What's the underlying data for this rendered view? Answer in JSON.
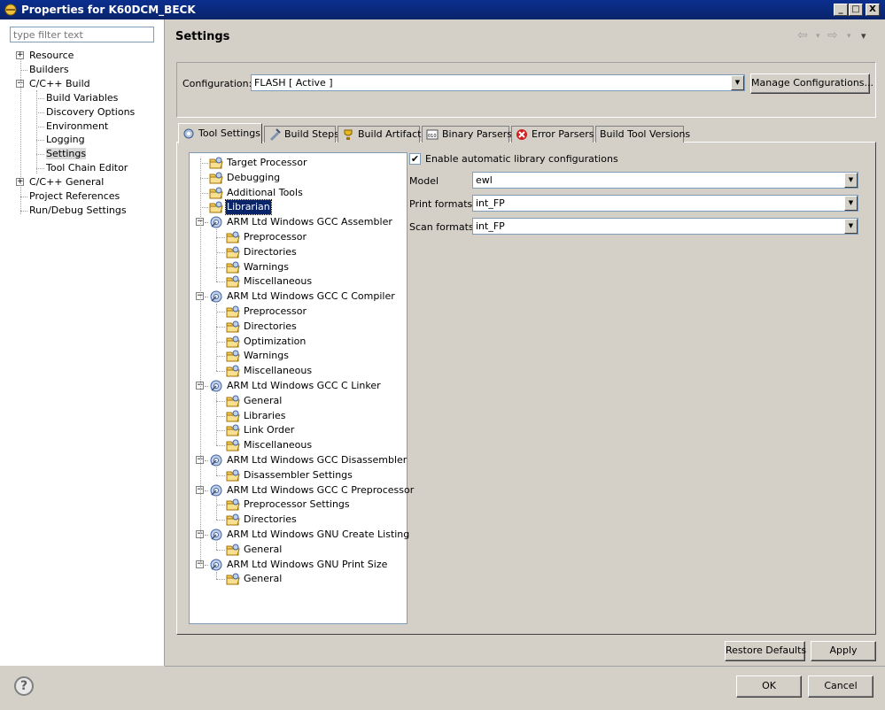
{
  "window": {
    "title": "Properties for K60DCM_BECK",
    "minimize": "_",
    "maximize": "□",
    "close": "X"
  },
  "filter": {
    "placeholder": "type filter text"
  },
  "left_tree": [
    {
      "label": "Resource",
      "expander": "+"
    },
    {
      "label": "Builders",
      "expander": ""
    },
    {
      "label": "C/C++ Build",
      "expander": "−"
    },
    {
      "label": "Build Variables",
      "expander": ""
    },
    {
      "label": "Discovery Options",
      "expander": ""
    },
    {
      "label": "Environment",
      "expander": ""
    },
    {
      "label": "Logging",
      "expander": ""
    },
    {
      "label": "Settings",
      "expander": ""
    },
    {
      "label": "Tool Chain Editor",
      "expander": ""
    },
    {
      "label": "C/C++ General",
      "expander": "+"
    },
    {
      "label": "Project References",
      "expander": ""
    },
    {
      "label": "Run/Debug Settings",
      "expander": ""
    }
  ],
  "header": {
    "title": "Settings",
    "back": "⇦",
    "forward": "⇨",
    "drop": "▾",
    "menu": "▾"
  },
  "config": {
    "label": "Configuration:",
    "value": "FLASH  [ Active ]",
    "manage_button": "Manage Configurations..."
  },
  "tabs": [
    {
      "label": "Tool Settings",
      "icon": "tool-settings-icon"
    },
    {
      "label": "Build Steps",
      "icon": "build-steps-icon"
    },
    {
      "label": "Build Artifact",
      "icon": "build-artifact-icon"
    },
    {
      "label": "Binary Parsers",
      "icon": "binary-parsers-icon"
    },
    {
      "label": "Error Parsers",
      "icon": "error-parsers-icon"
    },
    {
      "label": "Build Tool Versions",
      "icon": ""
    }
  ],
  "tool_tree": [
    {
      "label": "Target Processor",
      "icon": "folder-tool-icon",
      "expander": ""
    },
    {
      "label": "Debugging",
      "icon": "folder-tool-icon",
      "expander": ""
    },
    {
      "label": "Additional Tools",
      "icon": "folder-tool-icon",
      "expander": ""
    },
    {
      "label": "Librarian",
      "icon": "folder-tool-icon",
      "expander": ""
    },
    {
      "label": "ARM Ltd Windows GCC Assembler",
      "icon": "gear-tool-icon",
      "expander": "−"
    },
    {
      "label": "Preprocessor",
      "icon": "folder-tool-icon",
      "expander": ""
    },
    {
      "label": "Directories",
      "icon": "folder-tool-icon",
      "expander": ""
    },
    {
      "label": "Warnings",
      "icon": "folder-tool-icon",
      "expander": ""
    },
    {
      "label": "Miscellaneous",
      "icon": "folder-tool-icon",
      "expander": ""
    },
    {
      "label": "ARM Ltd Windows GCC C Compiler",
      "icon": "gear-tool-icon",
      "expander": "−"
    },
    {
      "label": "Preprocessor",
      "icon": "folder-tool-icon",
      "expander": ""
    },
    {
      "label": "Directories",
      "icon": "folder-tool-icon",
      "expander": ""
    },
    {
      "label": "Optimization",
      "icon": "folder-tool-icon",
      "expander": ""
    },
    {
      "label": "Warnings",
      "icon": "folder-tool-icon",
      "expander": ""
    },
    {
      "label": "Miscellaneous",
      "icon": "folder-tool-icon",
      "expander": ""
    },
    {
      "label": "ARM Ltd Windows GCC C Linker",
      "icon": "gear-tool-icon",
      "expander": "−"
    },
    {
      "label": "General",
      "icon": "folder-tool-icon",
      "expander": ""
    },
    {
      "label": "Libraries",
      "icon": "folder-tool-icon",
      "expander": ""
    },
    {
      "label": "Link Order",
      "icon": "folder-tool-icon",
      "expander": ""
    },
    {
      "label": "Miscellaneous",
      "icon": "folder-tool-icon",
      "expander": ""
    },
    {
      "label": "ARM Ltd Windows GCC Disassembler",
      "icon": "gear-tool-icon",
      "expander": "−"
    },
    {
      "label": "Disassembler Settings",
      "icon": "folder-tool-icon",
      "expander": ""
    },
    {
      "label": "ARM Ltd Windows GCC C Preprocessor",
      "icon": "gear-tool-icon",
      "expander": "−"
    },
    {
      "label": "Preprocessor Settings",
      "icon": "folder-tool-icon",
      "expander": ""
    },
    {
      "label": "Directories",
      "icon": "folder-tool-icon",
      "expander": ""
    },
    {
      "label": "ARM Ltd Windows GNU Create Listing",
      "icon": "gear-tool-icon",
      "expander": "−"
    },
    {
      "label": "General",
      "icon": "folder-tool-icon",
      "expander": ""
    },
    {
      "label": "ARM Ltd Windows GNU Print Size",
      "icon": "gear-tool-icon",
      "expander": "−"
    },
    {
      "label": "General",
      "icon": "folder-tool-icon",
      "expander": ""
    }
  ],
  "librarian": {
    "enable_auto_lib": "Enable automatic library configurations",
    "checkmark": "✔",
    "model_label": "Model",
    "model_value": "ewl",
    "print_label": "Print formats",
    "print_value": "int_FP",
    "scan_label": "Scan formats",
    "scan_value": "int_FP",
    "combo_arrow": "▼"
  },
  "buttons": {
    "restore_defaults": "Restore Defaults",
    "apply": "Apply",
    "ok": "OK",
    "cancel": "Cancel",
    "help": "?"
  },
  "colors": {
    "selection": "#0a246a",
    "titlebar": "#0a246a",
    "dialog": "#d4d0c8"
  }
}
